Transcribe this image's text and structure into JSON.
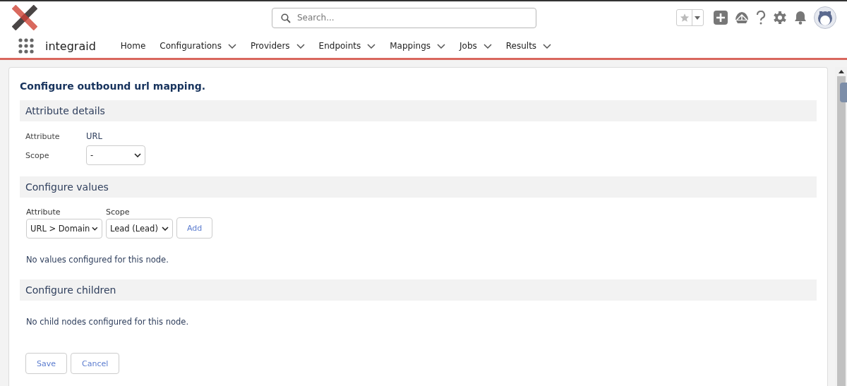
{
  "app": {
    "name": "integraid"
  },
  "search": {
    "placeholder": "Search..."
  },
  "nav": [
    {
      "label": "Home",
      "dropdown": false
    },
    {
      "label": "Configurations",
      "dropdown": true
    },
    {
      "label": "Providers",
      "dropdown": true
    },
    {
      "label": "Endpoints",
      "dropdown": true
    },
    {
      "label": "Mappings",
      "dropdown": true
    },
    {
      "label": "Jobs",
      "dropdown": true
    },
    {
      "label": "Results",
      "dropdown": true
    }
  ],
  "page": {
    "title": "Configure outbound url mapping."
  },
  "attribute_details": {
    "heading": "Attribute details",
    "attribute_label": "Attribute",
    "attribute_value": "URL",
    "scope_label": "Scope",
    "scope_value": "-"
  },
  "configure_values": {
    "heading": "Configure values",
    "attribute_label": "Attribute",
    "attribute_value": "URL > Domain",
    "scope_label": "Scope",
    "scope_value": "Lead (Lead)",
    "add_button": "Add",
    "empty_text": "No values configured for this node."
  },
  "configure_children": {
    "heading": "Configure children",
    "empty_text": "No child nodes configured for this node."
  },
  "buttons": [
    "Save",
    "Cancel"
  ]
}
